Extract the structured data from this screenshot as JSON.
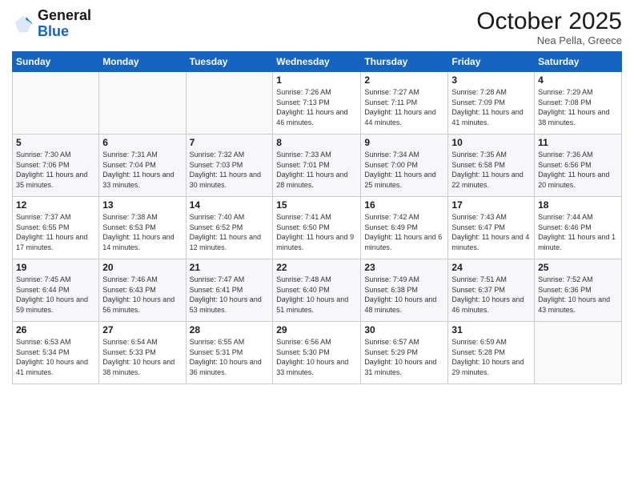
{
  "header": {
    "logo_general": "General",
    "logo_blue": "Blue",
    "month_title": "October 2025",
    "location": "Nea Pella, Greece"
  },
  "weekdays": [
    "Sunday",
    "Monday",
    "Tuesday",
    "Wednesday",
    "Thursday",
    "Friday",
    "Saturday"
  ],
  "weeks": [
    [
      {
        "day": "",
        "info": ""
      },
      {
        "day": "",
        "info": ""
      },
      {
        "day": "",
        "info": ""
      },
      {
        "day": "1",
        "info": "Sunrise: 7:26 AM\nSunset: 7:13 PM\nDaylight: 11 hours and 46 minutes."
      },
      {
        "day": "2",
        "info": "Sunrise: 7:27 AM\nSunset: 7:11 PM\nDaylight: 11 hours and 44 minutes."
      },
      {
        "day": "3",
        "info": "Sunrise: 7:28 AM\nSunset: 7:09 PM\nDaylight: 11 hours and 41 minutes."
      },
      {
        "day": "4",
        "info": "Sunrise: 7:29 AM\nSunset: 7:08 PM\nDaylight: 11 hours and 38 minutes."
      }
    ],
    [
      {
        "day": "5",
        "info": "Sunrise: 7:30 AM\nSunset: 7:06 PM\nDaylight: 11 hours and 35 minutes."
      },
      {
        "day": "6",
        "info": "Sunrise: 7:31 AM\nSunset: 7:04 PM\nDaylight: 11 hours and 33 minutes."
      },
      {
        "day": "7",
        "info": "Sunrise: 7:32 AM\nSunset: 7:03 PM\nDaylight: 11 hours and 30 minutes."
      },
      {
        "day": "8",
        "info": "Sunrise: 7:33 AM\nSunset: 7:01 PM\nDaylight: 11 hours and 28 minutes."
      },
      {
        "day": "9",
        "info": "Sunrise: 7:34 AM\nSunset: 7:00 PM\nDaylight: 11 hours and 25 minutes."
      },
      {
        "day": "10",
        "info": "Sunrise: 7:35 AM\nSunset: 6:58 PM\nDaylight: 11 hours and 22 minutes."
      },
      {
        "day": "11",
        "info": "Sunrise: 7:36 AM\nSunset: 6:56 PM\nDaylight: 11 hours and 20 minutes."
      }
    ],
    [
      {
        "day": "12",
        "info": "Sunrise: 7:37 AM\nSunset: 6:55 PM\nDaylight: 11 hours and 17 minutes."
      },
      {
        "day": "13",
        "info": "Sunrise: 7:38 AM\nSunset: 6:53 PM\nDaylight: 11 hours and 14 minutes."
      },
      {
        "day": "14",
        "info": "Sunrise: 7:40 AM\nSunset: 6:52 PM\nDaylight: 11 hours and 12 minutes."
      },
      {
        "day": "15",
        "info": "Sunrise: 7:41 AM\nSunset: 6:50 PM\nDaylight: 11 hours and 9 minutes."
      },
      {
        "day": "16",
        "info": "Sunrise: 7:42 AM\nSunset: 6:49 PM\nDaylight: 11 hours and 6 minutes."
      },
      {
        "day": "17",
        "info": "Sunrise: 7:43 AM\nSunset: 6:47 PM\nDaylight: 11 hours and 4 minutes."
      },
      {
        "day": "18",
        "info": "Sunrise: 7:44 AM\nSunset: 6:46 PM\nDaylight: 11 hours and 1 minute."
      }
    ],
    [
      {
        "day": "19",
        "info": "Sunrise: 7:45 AM\nSunset: 6:44 PM\nDaylight: 10 hours and 59 minutes."
      },
      {
        "day": "20",
        "info": "Sunrise: 7:46 AM\nSunset: 6:43 PM\nDaylight: 10 hours and 56 minutes."
      },
      {
        "day": "21",
        "info": "Sunrise: 7:47 AM\nSunset: 6:41 PM\nDaylight: 10 hours and 53 minutes."
      },
      {
        "day": "22",
        "info": "Sunrise: 7:48 AM\nSunset: 6:40 PM\nDaylight: 10 hours and 51 minutes."
      },
      {
        "day": "23",
        "info": "Sunrise: 7:49 AM\nSunset: 6:38 PM\nDaylight: 10 hours and 48 minutes."
      },
      {
        "day": "24",
        "info": "Sunrise: 7:51 AM\nSunset: 6:37 PM\nDaylight: 10 hours and 46 minutes."
      },
      {
        "day": "25",
        "info": "Sunrise: 7:52 AM\nSunset: 6:36 PM\nDaylight: 10 hours and 43 minutes."
      }
    ],
    [
      {
        "day": "26",
        "info": "Sunrise: 6:53 AM\nSunset: 5:34 PM\nDaylight: 10 hours and 41 minutes."
      },
      {
        "day": "27",
        "info": "Sunrise: 6:54 AM\nSunset: 5:33 PM\nDaylight: 10 hours and 38 minutes."
      },
      {
        "day": "28",
        "info": "Sunrise: 6:55 AM\nSunset: 5:31 PM\nDaylight: 10 hours and 36 minutes."
      },
      {
        "day": "29",
        "info": "Sunrise: 6:56 AM\nSunset: 5:30 PM\nDaylight: 10 hours and 33 minutes."
      },
      {
        "day": "30",
        "info": "Sunrise: 6:57 AM\nSunset: 5:29 PM\nDaylight: 10 hours and 31 minutes."
      },
      {
        "day": "31",
        "info": "Sunrise: 6:59 AM\nSunset: 5:28 PM\nDaylight: 10 hours and 29 minutes."
      },
      {
        "day": "",
        "info": ""
      }
    ]
  ]
}
